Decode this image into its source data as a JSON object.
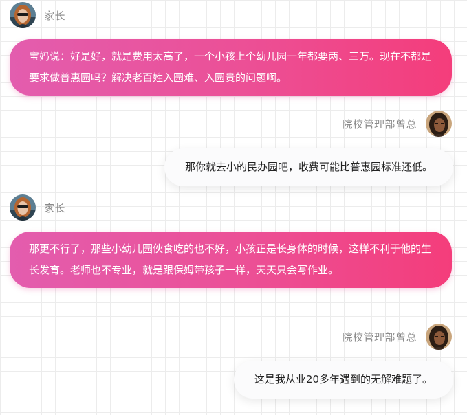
{
  "conversation": {
    "messages": [
      {
        "role": "parent",
        "sender": "家长",
        "text": "宝妈说：好是好，就是费用太高了，一个小孩上个幼儿园一年都要两、三万。现在不都是要求做普惠园吗？解决老百姓入园难、入园贵的问题啊。"
      },
      {
        "role": "school",
        "sender": "院校管理部曾总",
        "text": "那你就去小的民办园吧，收费可能比普惠园标准还低。"
      },
      {
        "role": "parent",
        "sender": "家长",
        "text": "那更不行了，那些小幼儿园伙食吃的也不好，小孩正是长身体的时候，这样不利于他的生长发育。老师也不专业，就是跟保姆带孩子一样，天天只会写作业。"
      },
      {
        "role": "school",
        "sender": "院校管理部曾总",
        "text": "这是我从业20多年遇到的无解难题了。"
      }
    ]
  },
  "colors": {
    "parent_bubble_start": "#e35dae",
    "parent_bubble_end": "#f43d7b",
    "reply_bubble": "#fbfbfc",
    "sender_name": "#8a8a8a"
  },
  "icons": {
    "parent_avatar": "woman-with-sunglasses-avatar",
    "school_avatar": "woman-avatar"
  }
}
